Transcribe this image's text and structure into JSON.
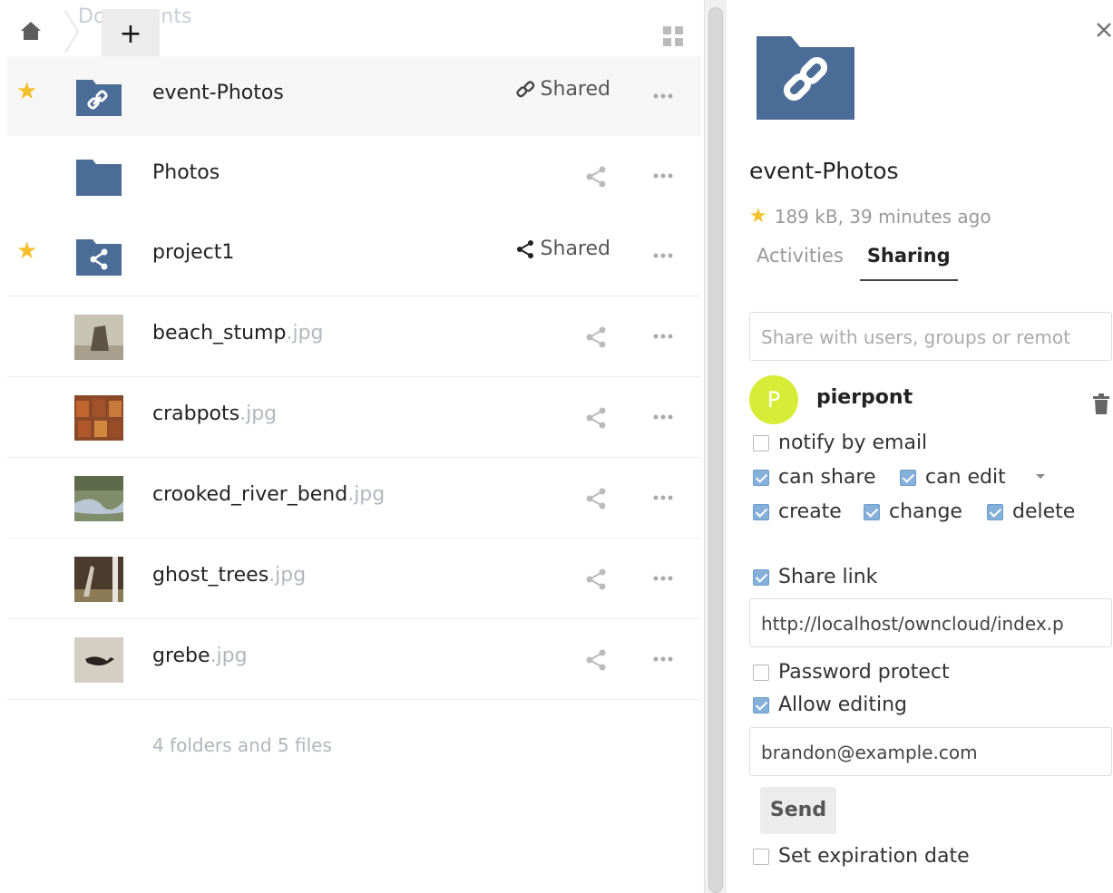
{
  "breadcrumb": {
    "ghost_label": "Documents",
    "new_button": "+"
  },
  "files": [
    {
      "name": "event-Photos",
      "ext": "",
      "favorite": true,
      "icon": "link-folder-icon",
      "shared_label": "Shared",
      "shared_icon": "link-icon",
      "selected": true
    },
    {
      "name": "Photos",
      "ext": "",
      "favorite": false,
      "icon": "folder-icon",
      "shared_label": "",
      "selected": false
    },
    {
      "name": "project1",
      "ext": "",
      "favorite": true,
      "icon": "shared-folder-icon",
      "shared_label": "Shared",
      "shared_icon": "share-icon",
      "selected": false
    },
    {
      "name": "beach_stump",
      "ext": ".jpg",
      "favorite": false,
      "icon": "image-thumbnail",
      "shared_label": "",
      "selected": false
    },
    {
      "name": "crabpots",
      "ext": ".jpg",
      "favorite": false,
      "icon": "image-thumbnail",
      "shared_label": "",
      "selected": false
    },
    {
      "name": "crooked_river_bend",
      "ext": ".jpg",
      "favorite": false,
      "icon": "image-thumbnail",
      "shared_label": "",
      "selected": false
    },
    {
      "name": "ghost_trees",
      "ext": ".jpg",
      "favorite": false,
      "icon": "image-thumbnail",
      "shared_label": "",
      "selected": false
    },
    {
      "name": "grebe",
      "ext": ".jpg",
      "favorite": false,
      "icon": "image-thumbnail",
      "shared_label": "",
      "selected": false
    }
  ],
  "summary": "4 folders and 5 files",
  "sidebar": {
    "title": "event-Photos",
    "meta": "189 kB, 39 minutes ago",
    "tabs": [
      "Activities",
      "Sharing"
    ],
    "active_tab": "Sharing",
    "share_placeholder": "Share with users, groups or remot",
    "share_user": {
      "initial": "P",
      "name": "pierpont",
      "avatar_color": "#d7ec37"
    },
    "permissions": {
      "notify_by_email": {
        "label": "notify by email",
        "checked": false
      },
      "can_share": {
        "label": "can share",
        "checked": true
      },
      "can_edit": {
        "label": "can edit",
        "checked": true
      },
      "create": {
        "label": "create",
        "checked": true
      },
      "change": {
        "label": "change",
        "checked": true
      },
      "delete": {
        "label": "delete",
        "checked": true
      }
    },
    "share_link": {
      "label": "Share link",
      "checked": true,
      "url": "http://localhost/owncloud/index.p"
    },
    "password_protect": {
      "label": "Password protect",
      "checked": false
    },
    "allow_editing": {
      "label": "Allow editing",
      "checked": true
    },
    "email_value": "brandon@example.com",
    "send_label": "Send",
    "expiration": {
      "label": "Set expiration date",
      "checked": false
    }
  },
  "colors": {
    "folder": "#4a6c96",
    "star": "#f5c02b",
    "checkbox": "#85b0da"
  }
}
